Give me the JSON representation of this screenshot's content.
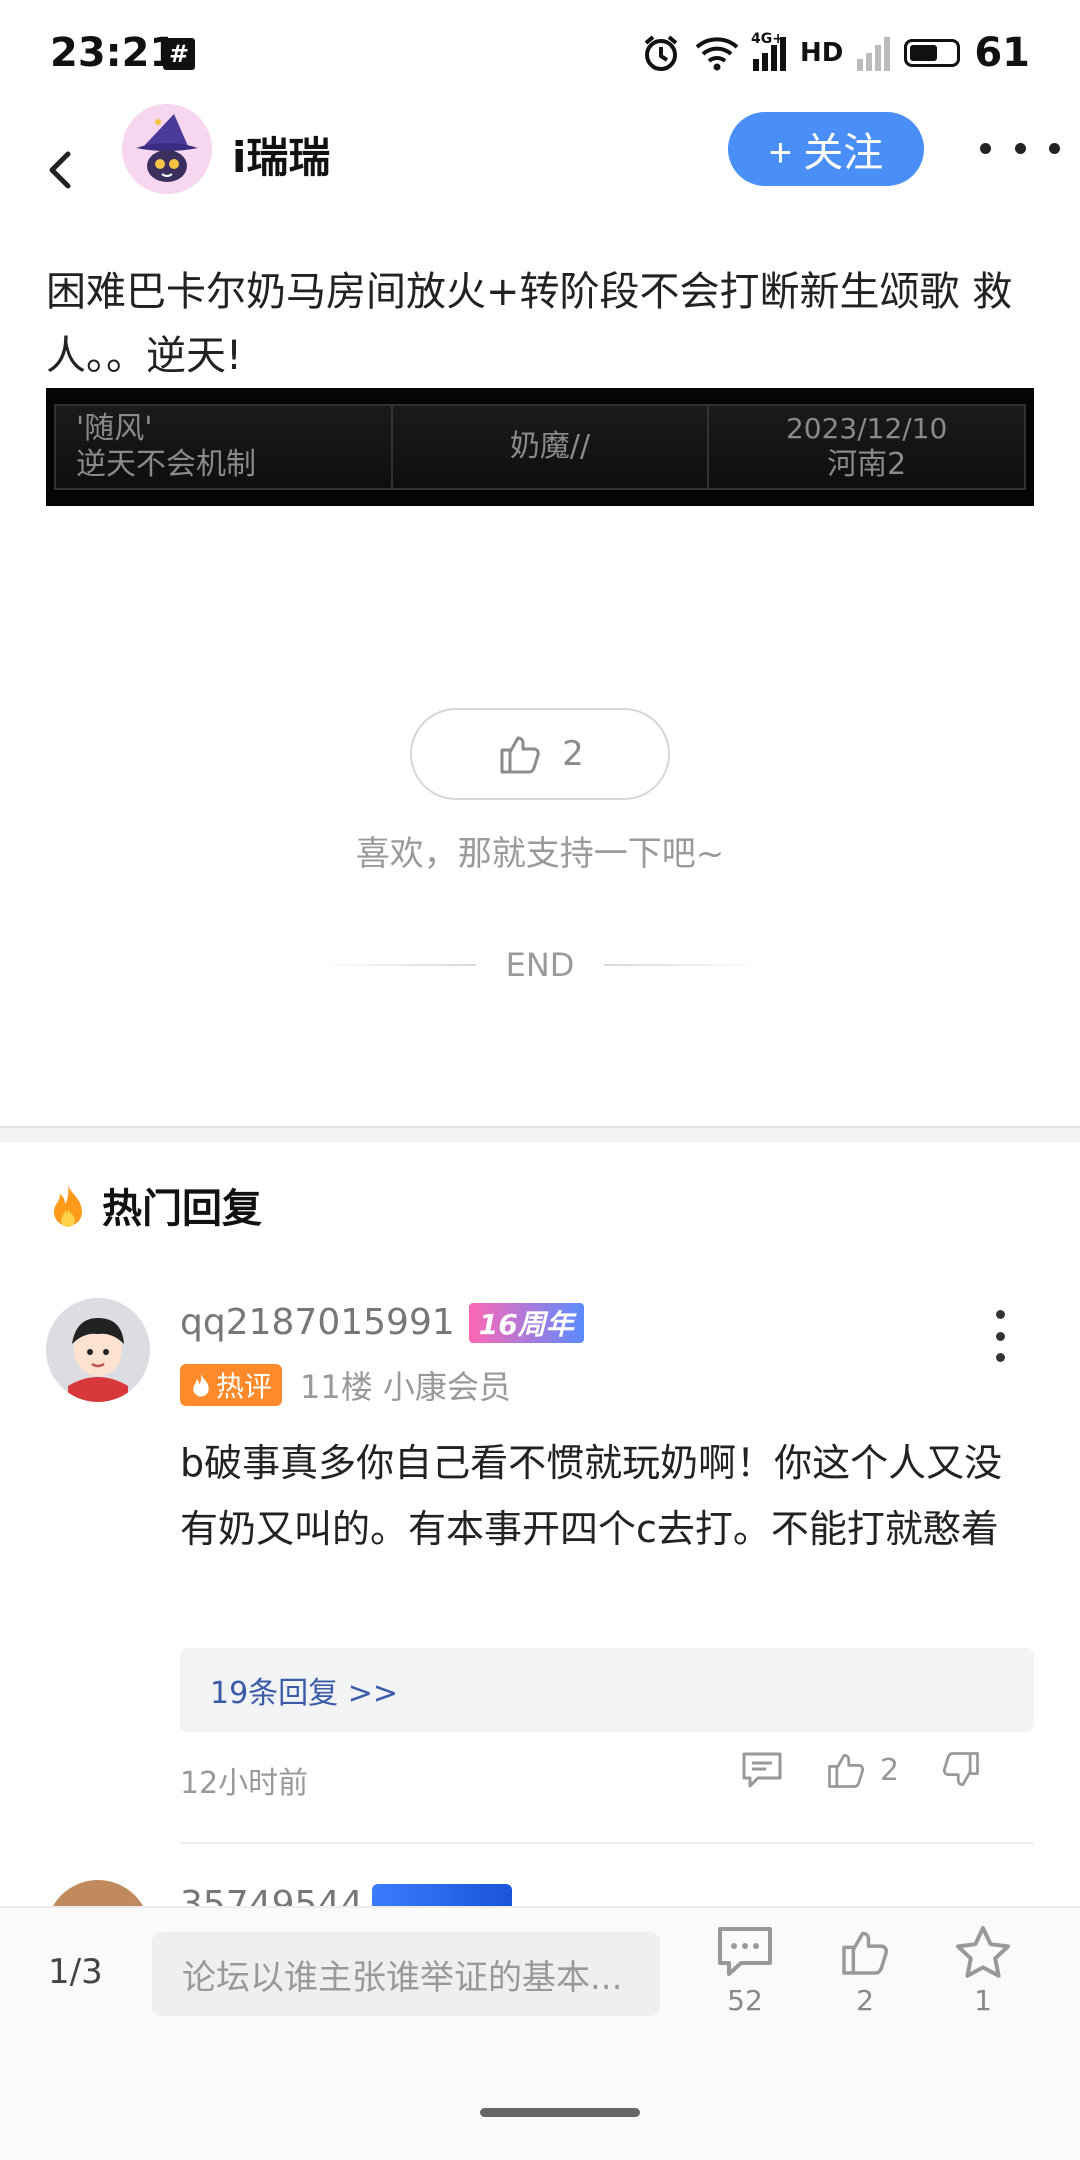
{
  "status_bar": {
    "time": "23:21",
    "battery": "61",
    "network": "4G+",
    "hd_label": "HD"
  },
  "header": {
    "username": "i瑞瑞",
    "follow_label": "+ 关注"
  },
  "post": {
    "text": "困难巴卡尔奶马房间放火+转阶段不会打断新生颂歌 救人。。逆天!",
    "banner": {
      "col1_line1": "'随风'",
      "col1_line2": "逆天不会机制",
      "col2": "奶魔//",
      "col3_line1": "2023/12/10",
      "col3_line2": "河南2"
    },
    "like_count": "2",
    "support_text": "喜欢，那就支持一下吧~",
    "end_label": "END"
  },
  "hot_replies": {
    "title": "热门回复",
    "comments": [
      {
        "username": "qq2187015991",
        "anniversary_badge": "16周年",
        "hot_badge": "热评",
        "floor_info": "11楼 小康会员",
        "body": "b破事真多你自己看不惯就玩奶啊！你这个人又没有奶又叫的。有本事开四个c去打。不能打就憨着",
        "replies_label": "19条回复 >>",
        "time": "12小时前",
        "like_count": "2"
      }
    ],
    "next_username": "35749544"
  },
  "bottom_bar": {
    "page_indicator": "1/3",
    "input_placeholder": "论坛以谁主张谁举证的基本...",
    "comment_count": "52",
    "like_count": "2",
    "favorite_count": "1"
  },
  "colors": {
    "accent": "#4a8ef7",
    "hot_badge": "#ff8a2b",
    "reply_link": "#3b5ba9"
  }
}
